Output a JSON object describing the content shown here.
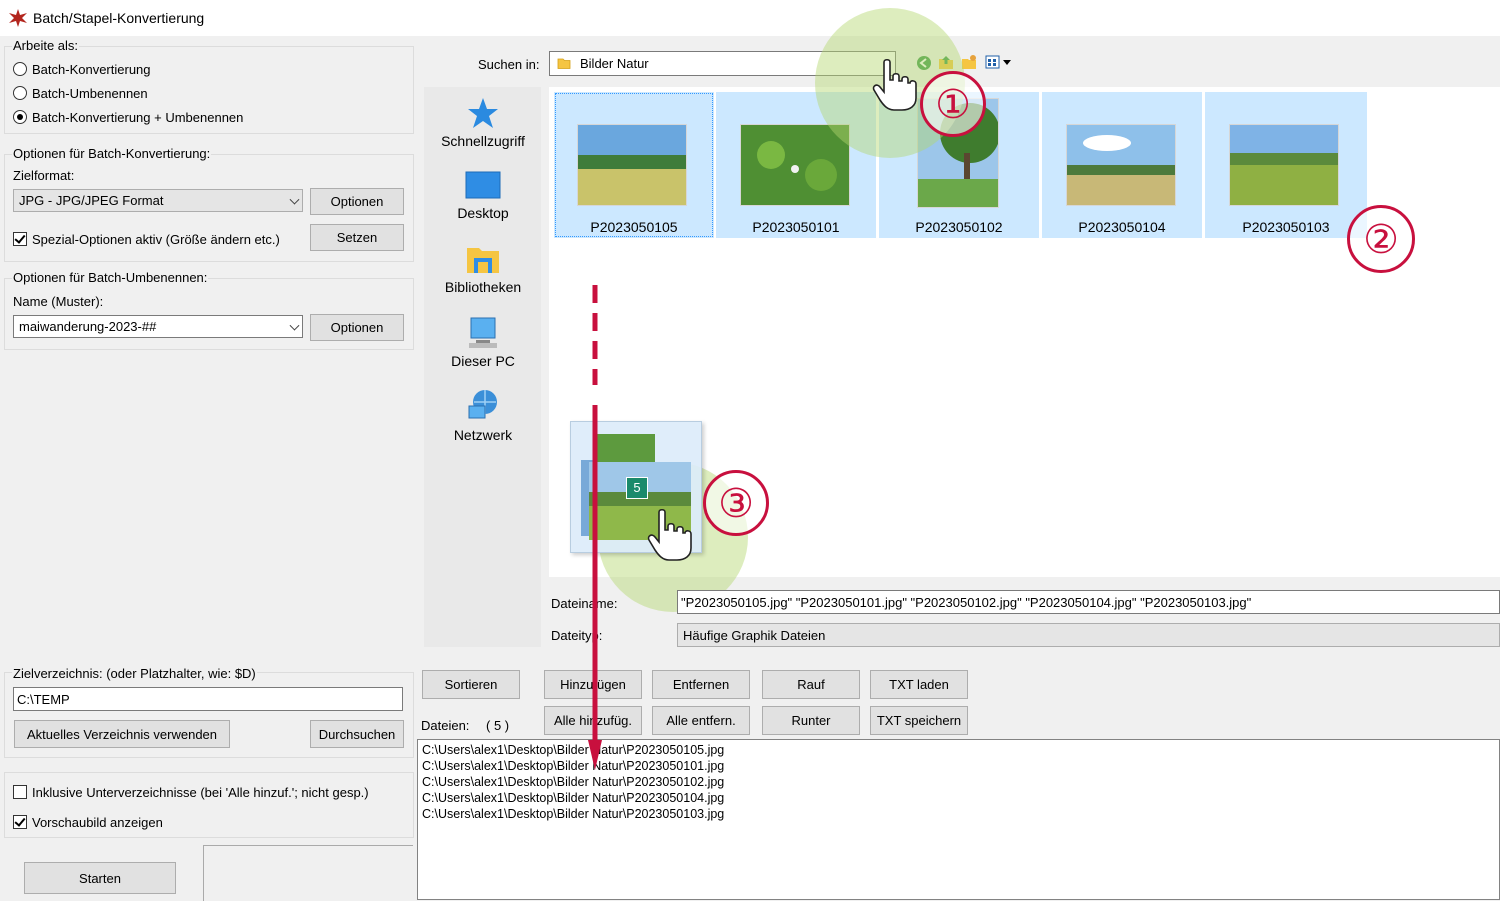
{
  "window": {
    "title": "Batch/Stapel-Konvertierung"
  },
  "work_as": {
    "heading": "Arbeite als:",
    "options": [
      "Batch-Konvertierung",
      "Batch-Umbenennen",
      "Batch-Konvertierung + Umbenennen"
    ],
    "selected": "Batch-Konvertierung + Umbenennen"
  },
  "convert_options": {
    "heading": "Optionen für Batch-Konvertierung:",
    "format_label": "Zielformat:",
    "format_value": "JPG - JPG/JPEG Format",
    "options_button": "Optionen",
    "special_checkbox": "Spezial-Optionen aktiv (Größe ändern etc.)",
    "special_checked": true,
    "set_button": "Setzen"
  },
  "rename_options": {
    "heading": "Optionen für Batch-Umbenennen:",
    "name_label": "Name (Muster):",
    "name_value": "maiwanderung-2023-##",
    "options_button": "Optionen"
  },
  "target_dir": {
    "label": "Zielverzeichnis: (oder Platzhalter, wie: $D)",
    "value": "C:\\TEMP",
    "use_current_button": "Aktuelles Verzeichnis verwenden",
    "browse_button": "Durchsuchen"
  },
  "include_subdirs": {
    "label": "Inklusive Unterverzeichnisse (bei 'Alle hinzuf.'; nicht gesp.)",
    "checked": false
  },
  "show_preview": {
    "label": "Vorschaubild anzeigen",
    "checked": true
  },
  "start_button": "Starten",
  "file_dialog": {
    "look_in_label": "Suchen in:",
    "look_in_value": "Bilder Natur",
    "places": [
      "Schnellzugriff",
      "Desktop",
      "Bibliotheken",
      "Dieser PC",
      "Netzwerk"
    ],
    "thumbnails": [
      "P2023050105",
      "P2023050101",
      "P2023050102",
      "P2023050104",
      "P2023050103"
    ],
    "filename_label": "Dateiname:",
    "filename_value": "\"P2023050105.jpg\" \"P2023050101.jpg\" \"P2023050102.jpg\" \"P2023050104.jpg\" \"P2023050103.jpg\"",
    "filetype_label": "Dateityp:",
    "filetype_value": "Häufige Graphik Dateien",
    "drag_count": "5"
  },
  "list_controls": {
    "sort": "Sortieren",
    "add": "Hinzufügen",
    "remove": "Entfernen",
    "up": "Rauf",
    "load_txt": "TXT laden",
    "add_all": "Alle hinzufüg.",
    "remove_all": "Alle entfern.",
    "down": "Runter",
    "save_txt": "TXT speichern",
    "files_label": "Dateien:",
    "files_count": "( 5 )"
  },
  "file_list": [
    "C:\\Users\\alex1\\Desktop\\Bilder Natur\\P2023050105.jpg",
    "C:\\Users\\alex1\\Desktop\\Bilder Natur\\P2023050101.jpg",
    "C:\\Users\\alex1\\Desktop\\Bilder Natur\\P2023050102.jpg",
    "C:\\Users\\alex1\\Desktop\\Bilder Natur\\P2023050104.jpg",
    "C:\\Users\\alex1\\Desktop\\Bilder Natur\\P2023050103.jpg"
  ],
  "annotations": {
    "step1": "①",
    "step2": "②",
    "step3": "③",
    "color": "#c8103e"
  }
}
